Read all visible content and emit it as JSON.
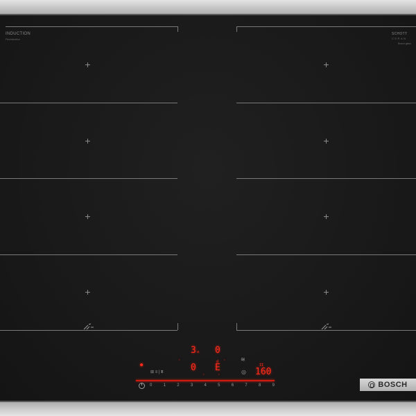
{
  "cooktop": {
    "top_left_label": "INDUCTION",
    "top_left_sublabel": "FlexInduction",
    "top_right_label": "SCHOTT",
    "top_right_sublabel": "CERAN",
    "top_right_micro": "Bosch glass"
  },
  "controls": {
    "display_left_top": "3",
    "display_left_top_sub": "a",
    "display_right_top": "0",
    "display_left_bottom": "0",
    "display_right_bottom": "E",
    "display_right_bottom_sub": "d",
    "timer_value": "160",
    "timer_small": "II",
    "func_symbols": "⊞ ≡ | ⩩",
    "timer_symbol": "◎",
    "wipe_symbol": "≋",
    "scale": [
      "0",
      "1",
      "2",
      "3",
      "4",
      "5",
      "6",
      "7",
      "8",
      "9"
    ]
  },
  "brand": {
    "name": "BOSCH"
  }
}
